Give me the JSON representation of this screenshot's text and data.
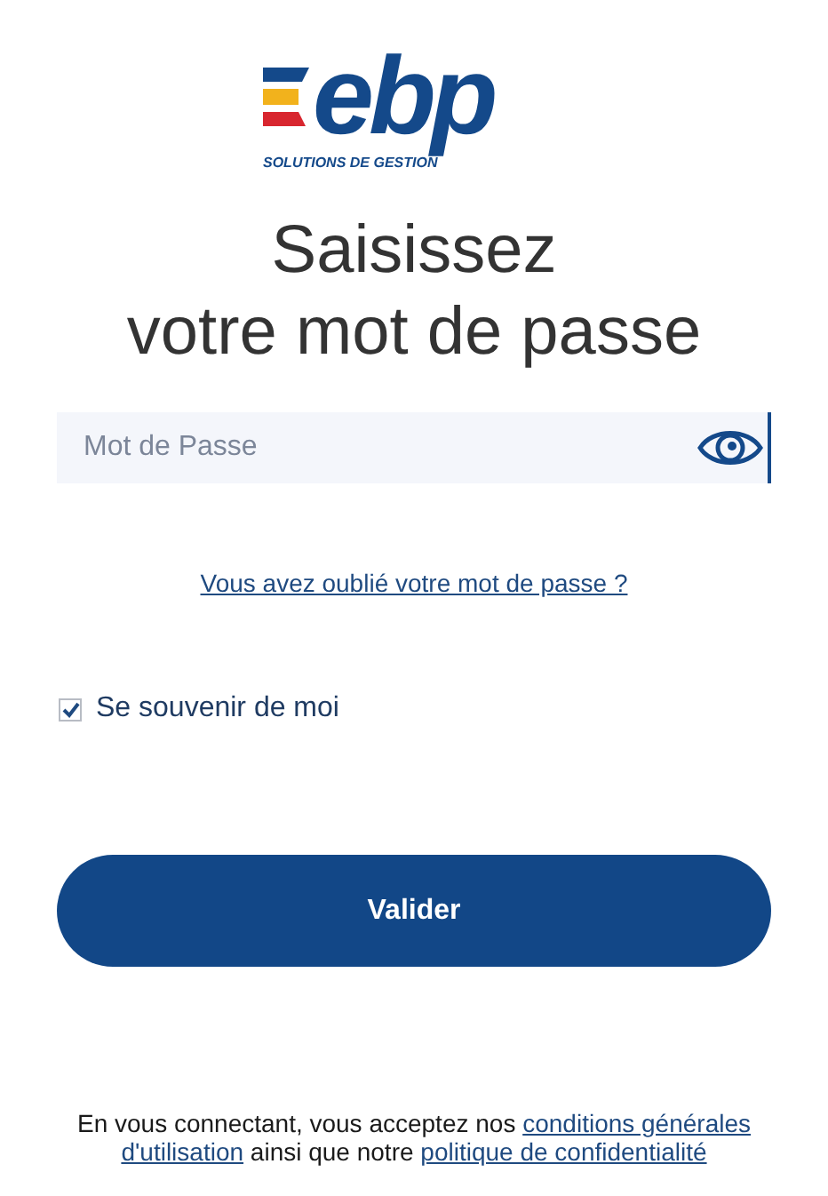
{
  "logo": {
    "wordmark": "ebp",
    "tagline": "SOLUTIONS DE GESTION"
  },
  "heading": [
    "Saisissez",
    "votre mot de passe"
  ],
  "password_field": {
    "placeholder": "Mot de Passe"
  },
  "forgot_link": "Vous avez oublié votre mot de passe ?",
  "remember_me": {
    "label": "Se souvenir de moi",
    "checked": true
  },
  "submit_button": "Valider",
  "footer": [
    {
      "kind": "text",
      "text": "En vous connectant, vous acceptez nos"
    },
    {
      "kind": "link",
      "text": "conditions générales"
    },
    {
      "kind": "break"
    },
    {
      "kind": "link",
      "text": "d'utilisation"
    },
    {
      "kind": "text",
      "text": "ainsi que notre"
    },
    {
      "kind": "link",
      "text": "politique de confidentialité"
    }
  ]
}
